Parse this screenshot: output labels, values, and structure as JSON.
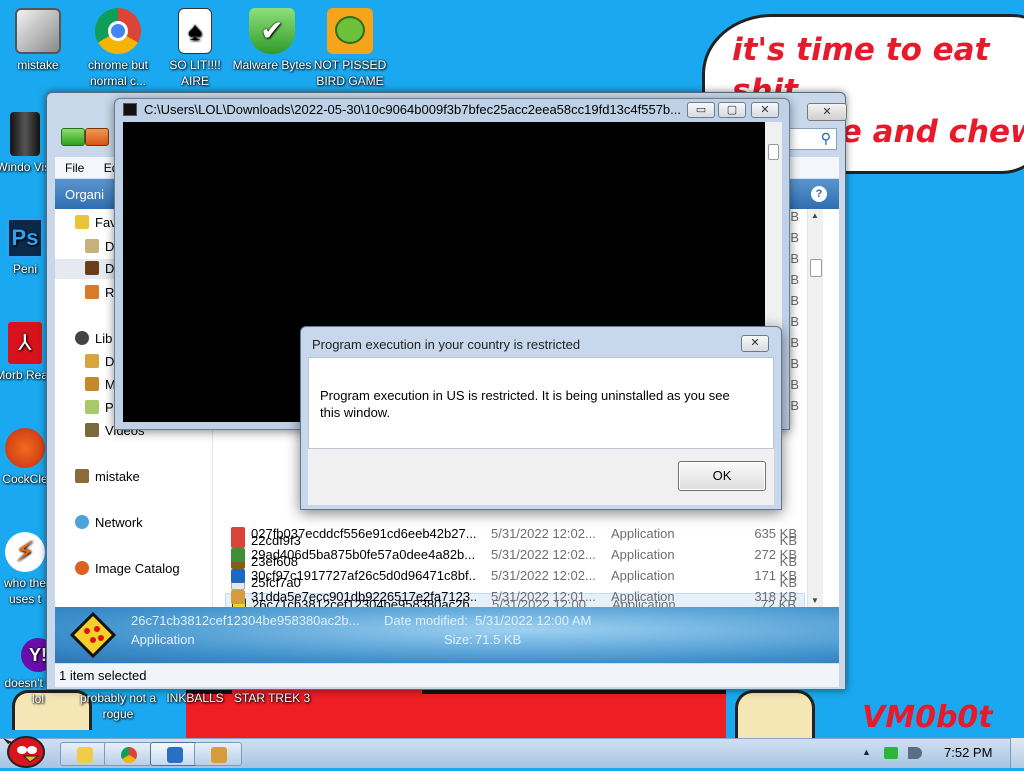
{
  "wallpaper": {
    "bubble_text": "it's time to eat shit\nand die and chew\ngum",
    "signature": "VM0b0t"
  },
  "desktop_icons": [
    {
      "label": "mistake",
      "icon": "computer-stickers-icon"
    },
    {
      "label": "chrome but normal c...",
      "icon": "chrome-icon"
    },
    {
      "label": "SO LIT!!!! AIRE",
      "icon": "cards-icon"
    },
    {
      "label": "Malware Bytes",
      "icon": "shield-check-icon"
    },
    {
      "label": "NOT PISSED BIRD GAME",
      "icon": "green-pig-icon"
    },
    {
      "label": "Windo Vist",
      "icon": "trash-can-icon"
    },
    {
      "label": "Peni",
      "icon": "photoshop-icon"
    },
    {
      "label": "Morb Read",
      "icon": "pdf-reader-icon"
    },
    {
      "label": "CockCle",
      "icon": "ccleaner-icon"
    },
    {
      "label": "who the uses t",
      "icon": "bolt-icon"
    },
    {
      "label": "doesn't work lol",
      "icon": "yahoo-icon"
    },
    {
      "label": "probably not a rogue",
      "icon": "app-icon"
    },
    {
      "label": "INKBALLS",
      "icon": "app-icon"
    },
    {
      "label": "STAR TREK 3",
      "icon": "app-icon"
    }
  ],
  "explorer": {
    "menu": [
      "File",
      "Ed"
    ],
    "toolbar_organize": "Organi",
    "help": "?",
    "nav": [
      {
        "label": "Fav",
        "icon": "star-icon"
      },
      {
        "label": "D",
        "icon": "folder-icon"
      },
      {
        "label": "D",
        "icon": "folder-icon"
      },
      {
        "label": "R",
        "icon": "folder-icon"
      },
      {
        "label": "Lib",
        "icon": "library-icon"
      },
      {
        "label": "D",
        "icon": "folder-icon"
      },
      {
        "label": "M",
        "icon": "music-icon"
      },
      {
        "label": "P",
        "icon": "picture-icon"
      },
      {
        "label": "Videos",
        "icon": "video-icon"
      },
      {
        "label": "mistake",
        "icon": "homegroup-icon"
      },
      {
        "label": "Network",
        "icon": "network-icon"
      },
      {
        "label": "Image Catalog",
        "icon": "catalog-icon"
      }
    ],
    "kb_column": [
      "KB",
      "KB",
      "KB",
      "KB",
      "KB",
      "KB",
      "KB",
      "KB",
      "KB",
      "KB"
    ],
    "files": [
      {
        "name": "22cdf9f3",
        "date": "",
        "type": "",
        "size": "KB",
        "selected": false
      },
      {
        "name": "23ef608",
        "date": "",
        "type": "",
        "size": "KB",
        "selected": false
      },
      {
        "name": "25fcf7a0",
        "date": "",
        "type": "",
        "size": "KB",
        "selected": false
      },
      {
        "name": "26c71cb3812cef12304be958380ac2b...",
        "date": "5/31/2022 12:00...",
        "type": "Application",
        "size": "72 KB",
        "selected": true
      },
      {
        "name": "027fb037ecddcf556e91cd6eeb42b27...",
        "date": "5/31/2022 12:02...",
        "type": "Application",
        "size": "635 KB",
        "selected": false
      },
      {
        "name": "29ad406d5ba875b0fe57a0dee4a82b...",
        "date": "5/31/2022 12:02...",
        "type": "Application",
        "size": "272 KB",
        "selected": false
      },
      {
        "name": "30cf97c1917727af26c5d0d96471c8bf...",
        "date": "5/31/2022 12:02...",
        "type": "Application",
        "size": "171 KB",
        "selected": false
      },
      {
        "name": "31dda5e7ecc901db9226517e2fa7123...",
        "date": "5/31/2022 12:01...",
        "type": "Application",
        "size": "318 KB",
        "selected": false
      }
    ],
    "details": {
      "name": "26c71cb3812cef12304be958380ac2b...",
      "type": "Application",
      "modified_label": "Date modified:",
      "modified": "5/31/2022 12:00 AM",
      "size_label": "Size:",
      "size": "71.5 KB"
    },
    "status": "1 item selected",
    "close": "✕"
  },
  "console": {
    "title": "C:\\Users\\LOL\\Downloads\\2022-05-30\\10c9064b009f3b7bfec25acc2eea58cc19fd13c4f557b...",
    "min": "▭",
    "max": "▢",
    "close": "✕"
  },
  "dialog": {
    "title": "Program execution in your country is restricted",
    "message": "Program execution in US is restricted. It is being uninstalled as you see this window.",
    "ok": "OK",
    "close": "✕"
  },
  "taskbar": {
    "time": "7:52 PM",
    "tray_arrow": "▲"
  }
}
